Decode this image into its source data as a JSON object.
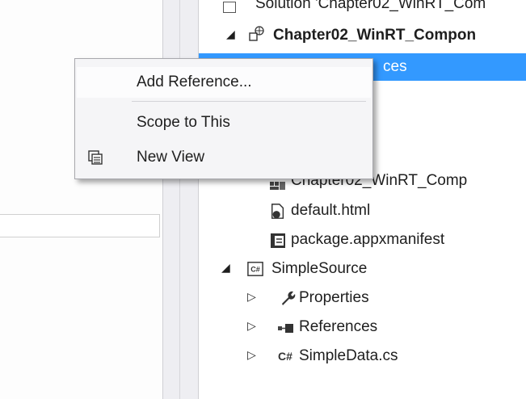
{
  "context_menu": {
    "items": [
      {
        "label": "Add Reference..."
      },
      {
        "label": "Scope to This"
      },
      {
        "label": "New View",
        "icon": "new-view-icon"
      }
    ]
  },
  "solution_explorer": {
    "solution_row": "Solution 'Chapter02_WinRT_Com",
    "project": "Chapter02_WinRT_Compon",
    "selected_item": "References",
    "selected_visible_text": "ces",
    "items": [
      "Chapter02_WinRT_Comp",
      "default.html",
      "package.appxmanifest"
    ],
    "second_project": "SimpleSource",
    "second_project_items": [
      "Properties",
      "References",
      "SimpleData.cs"
    ]
  },
  "colors": {
    "selection": "#3399ff",
    "menu_bg": "#f5f5f7"
  }
}
